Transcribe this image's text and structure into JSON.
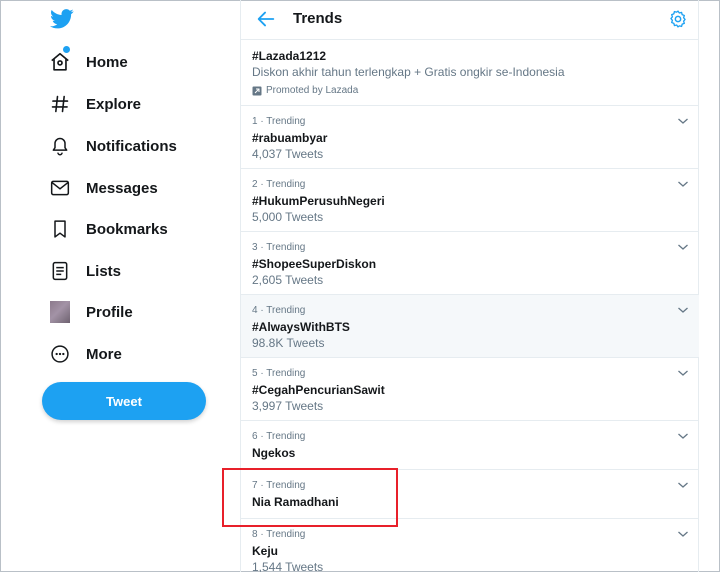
{
  "sidebar": {
    "items": [
      {
        "label": "Home",
        "icon": "home-icon"
      },
      {
        "label": "Explore",
        "icon": "hashtag-icon"
      },
      {
        "label": "Notifications",
        "icon": "bell-icon"
      },
      {
        "label": "Messages",
        "icon": "envelope-icon"
      },
      {
        "label": "Bookmarks",
        "icon": "bookmark-icon"
      },
      {
        "label": "Lists",
        "icon": "list-icon"
      },
      {
        "label": "Profile",
        "icon": "avatar"
      },
      {
        "label": "More",
        "icon": "more-circle-icon"
      }
    ],
    "tweet_label": "Tweet"
  },
  "header": {
    "title": "Trends"
  },
  "promoted": {
    "tag": "#Lazada1212",
    "description": "Diskon akhir tahun terlengkap + Gratis ongkir se-Indonesia",
    "promoted_by": "Promoted by Lazada"
  },
  "trends": [
    {
      "meta": "1 · Trending",
      "name": "#rabuambyar",
      "count": "4,037 Tweets"
    },
    {
      "meta": "2 · Trending",
      "name": "#HukumPerusuhNegeri",
      "count": "5,000 Tweets"
    },
    {
      "meta": "3 · Trending",
      "name": "#ShopeeSuperDiskon",
      "count": "2,605 Tweets"
    },
    {
      "meta": "4 · Trending",
      "name": "#AlwaysWithBTS",
      "count": "98.8K Tweets"
    },
    {
      "meta": "5 · Trending",
      "name": "#CegahPencurianSawit",
      "count": "3,997 Tweets"
    },
    {
      "meta": "6 · Trending",
      "name": "Ngekos",
      "count": ""
    },
    {
      "meta": "7 · Trending",
      "name": "Nia Ramadhani",
      "count": ""
    },
    {
      "meta": "8 · Trending",
      "name": "Keju",
      "count": "1,544 Tweets"
    }
  ],
  "colors": {
    "accent": "#1da1f2",
    "highlight": "#e8202a"
  }
}
